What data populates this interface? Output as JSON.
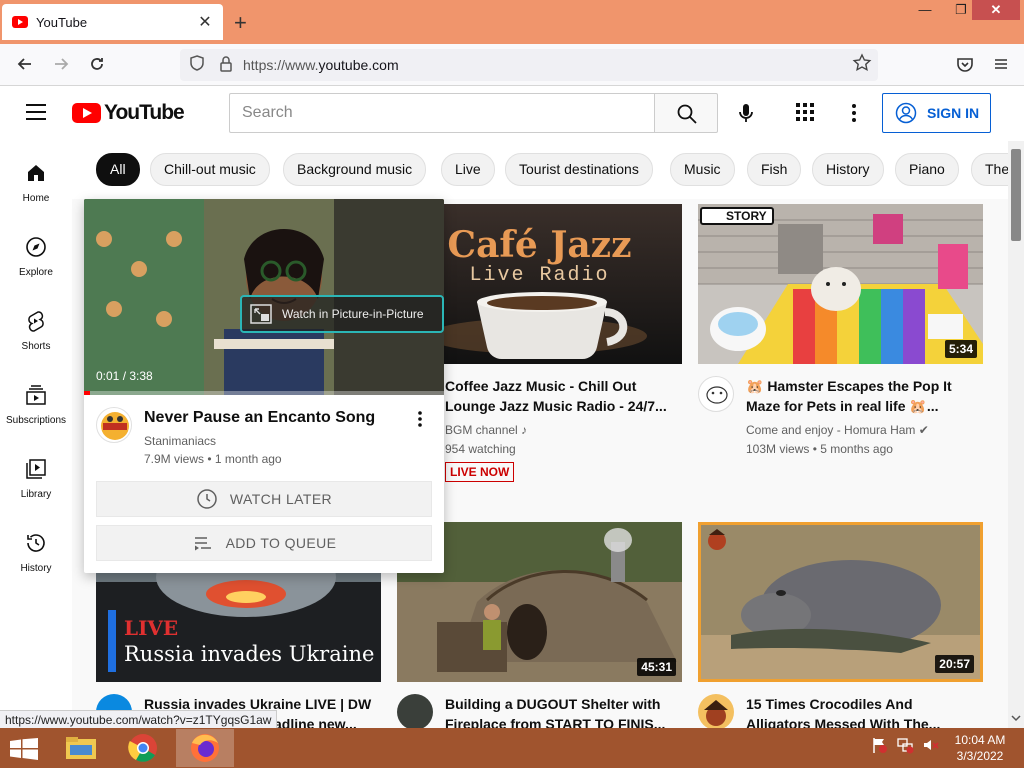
{
  "browser": {
    "tab_title": "YouTube",
    "tab_close": "✕",
    "new_tab": "+",
    "url_prefix": "https://www.",
    "url_domain": "youtube.com",
    "window_min": "—",
    "window_max": "❐",
    "window_close": "✕"
  },
  "header": {
    "logo_text": "YouTube",
    "search_placeholder": "Search",
    "signin_label": "SIGN IN"
  },
  "chips": [
    "All",
    "Chill-out music",
    "Background music",
    "Live",
    "Tourist destinations",
    "Music",
    "Fish",
    "History",
    "Piano",
    "The"
  ],
  "sidebar": [
    {
      "label": "Home"
    },
    {
      "label": "Explore"
    },
    {
      "label": "Shorts"
    },
    {
      "label": "Subscriptions"
    },
    {
      "label": "Library"
    },
    {
      "label": "History"
    }
  ],
  "hover_card": {
    "time": "0:01 / 3:38",
    "pip_label": "Watch in Picture-in-Picture",
    "title": "Never Pause an Encanto Song",
    "channel": "Stanimaniacs",
    "meta": "7.9M views • 1 month ago",
    "watch_later": "WATCH LATER",
    "add_queue": "ADD TO QUEUE"
  },
  "videos": [
    {
      "thumb_line1": "Café Jazz",
      "thumb_line2": "Live Radio",
      "title_1": "Coffee Jazz Music - Chill Out",
      "title_2": "Lounge Jazz Music Radio - 24/7...",
      "channel": "BGM channel ♪",
      "meta": "954 watching",
      "badge": "LIVE NOW"
    },
    {
      "thumb_badge": "STORY",
      "duration": "5:34",
      "title_1": "🐹 Hamster Escapes the Pop It",
      "title_2": "Maze for Pets in real life 🐹...",
      "channel": "Come and enjoy - Homura Ham ✔",
      "meta": "103M views • 5 months ago"
    },
    {
      "thumb_live": "LIVE",
      "thumb_caption": "Russia invades Ukraine",
      "title_1": "Russia invades Ukraine LIVE | DW",
      "title_2": "adline new..."
    },
    {
      "duration": "45:31",
      "title_1": "Building a DUGOUT Shelter with",
      "title_2": "Fireplace from START TO FINIS..."
    },
    {
      "duration": "20:57",
      "title_1": "15 Times Crocodiles And",
      "title_2": "Alligators Messed With The..."
    }
  ],
  "status_url": "https://www.youtube.com/watch?v=z1TYgqsG1aw",
  "taskbar": {
    "time": "10:04 AM",
    "date": "3/3/2022"
  }
}
